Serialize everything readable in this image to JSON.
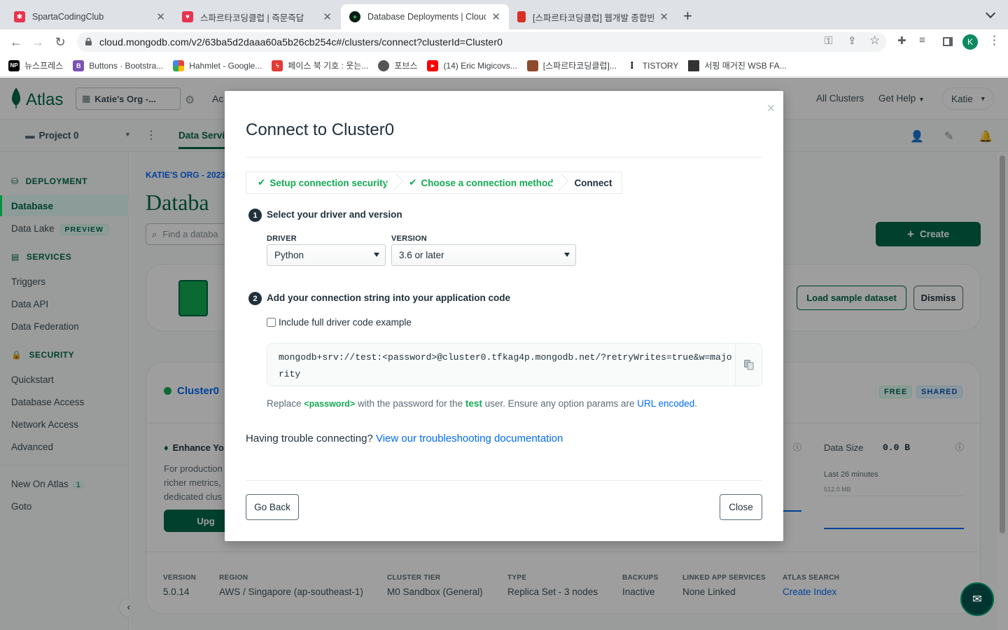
{
  "browser": {
    "tabs": [
      {
        "title": "SpartaCodingClub",
        "favicon_color": "#e8344e"
      },
      {
        "title": "스파르타코딩클럽 | 즉문즉답",
        "favicon_color": "#e8344e"
      },
      {
        "title": "Database Deployments | Cloud",
        "favicon_color": "#0b1d14"
      },
      {
        "title": "[스파르타코딩클럽] 웹개발 종합반 -",
        "favicon_color": "#d93025"
      }
    ],
    "url": "cloud.mongodb.com/v2/63ba5d2daaa60a5b26cb254c#/clusters/connect?clusterId=Cluster0",
    "profile_initial": "K",
    "bookmarks": [
      {
        "label": "뉴스프레스",
        "color": "#000000",
        "glyph": "NP"
      },
      {
        "label": "Buttons · Bootstra...",
        "color": "#7952b3",
        "glyph": "B"
      },
      {
        "label": "Hahmlet - Google...",
        "color": "#4285f4",
        "glyph": ""
      },
      {
        "label": "페이스 북 기호 : 웃는...",
        "color": "#e53935",
        "glyph": "ϟ"
      },
      {
        "label": "포브스",
        "color": "#555555",
        "glyph": "◍"
      },
      {
        "label": "(14) Eric Migicovs...",
        "color": "#ff0000",
        "glyph": "▶"
      },
      {
        "label": "[스파르타코딩클럽]...",
        "color": "#8d4b2a",
        "glyph": ""
      },
      {
        "label": "TISTORY",
        "color": "#ffffff",
        "glyph": "⁚"
      },
      {
        "label": "서핑 매거진 WSB FA...",
        "color": "#333333",
        "glyph": ""
      }
    ]
  },
  "atlas": {
    "logo_text": "Atlas",
    "org_selector": "Katie's Org -...",
    "top_partial": "Ac",
    "top_links": {
      "all_clusters": "All Clusters",
      "get_help": "Get Help",
      "user": "Katie"
    },
    "project_selector": "Project 0",
    "subnav_tab": "Data Servi",
    "sidebar": {
      "deployment": "DEPLOYMENT",
      "database": "Database",
      "data_lake": "Data Lake",
      "preview_badge": "PREVIEW",
      "services": "SERVICES",
      "triggers": "Triggers",
      "data_api": "Data API",
      "data_federation": "Data Federation",
      "security": "SECURITY",
      "quickstart": "Quickstart",
      "database_access": "Database Access",
      "network_access": "Network Access",
      "advanced": "Advanced",
      "new_on_atlas": "New On Atlas",
      "new_count": "1",
      "goto": "Goto"
    },
    "breadcrumb": "KATIE'S ORG - 2023",
    "page_title": "Databa",
    "search_placeholder": "Find a databa",
    "create_button": "Create",
    "load_sample": "Load sample dataset",
    "dismiss": "Dismiss",
    "cluster_name": "Cluster0",
    "badge_free": "FREE",
    "badge_shared": "SHARED",
    "enhance_title": "Enhance Yo",
    "enhance_lines": [
      "For production",
      "richer metrics,",
      "dedicated clus"
    ],
    "upgrade_partial": "Upg",
    "data_size_label": "Data Size",
    "data_size_value": "0.0 B",
    "last_minutes": "Last 26 minutes",
    "chart_max": "512.0 MB",
    "meta": [
      {
        "label": "VERSION",
        "value": "5.0.14"
      },
      {
        "label": "REGION",
        "value": "AWS / Singapore (ap-southeast-1)"
      },
      {
        "label": "CLUSTER TIER",
        "value": "M0 Sandbox (General)"
      },
      {
        "label": "TYPE",
        "value": "Replica Set - 3 nodes"
      },
      {
        "label": "BACKUPS",
        "value": "Inactive"
      },
      {
        "label": "LINKED APP SERVICES",
        "value": "None Linked"
      },
      {
        "label": "ATLAS SEARCH",
        "value": "Create Index"
      }
    ]
  },
  "modal": {
    "title": "Connect to Cluster0",
    "steps": [
      "Setup connection security",
      "Choose a connection method",
      "Connect"
    ],
    "section1": {
      "number": "1",
      "title": "Select your driver and version"
    },
    "driver_label": "DRIVER",
    "driver_value": "Python",
    "version_label": "VERSION",
    "version_value": "3.6 or later",
    "section2": {
      "number": "2",
      "title": "Add your connection string into your application code"
    },
    "include_full_label": "Include full driver code example",
    "include_full_checked": false,
    "connection_string": "mongodb+srv://test:<password>@cluster0.tfkag4p.mongodb.net/?retryWrites=true&w=majority",
    "note": {
      "pre": "Replace ",
      "password": "<password>",
      "mid": " with the password for the ",
      "user": "test",
      "post": " user. Ensure any option params are ",
      "link": "URL encoded",
      "end": "."
    },
    "trouble_text": "Having trouble connecting?",
    "trouble_link": "View our troubleshooting documentation",
    "go_back": "Go Back",
    "close": "Close",
    "close_x": "×"
  },
  "colors": {
    "brand_green": "#00684a",
    "success_green": "#13aa52",
    "link_blue": "#016bf8"
  }
}
